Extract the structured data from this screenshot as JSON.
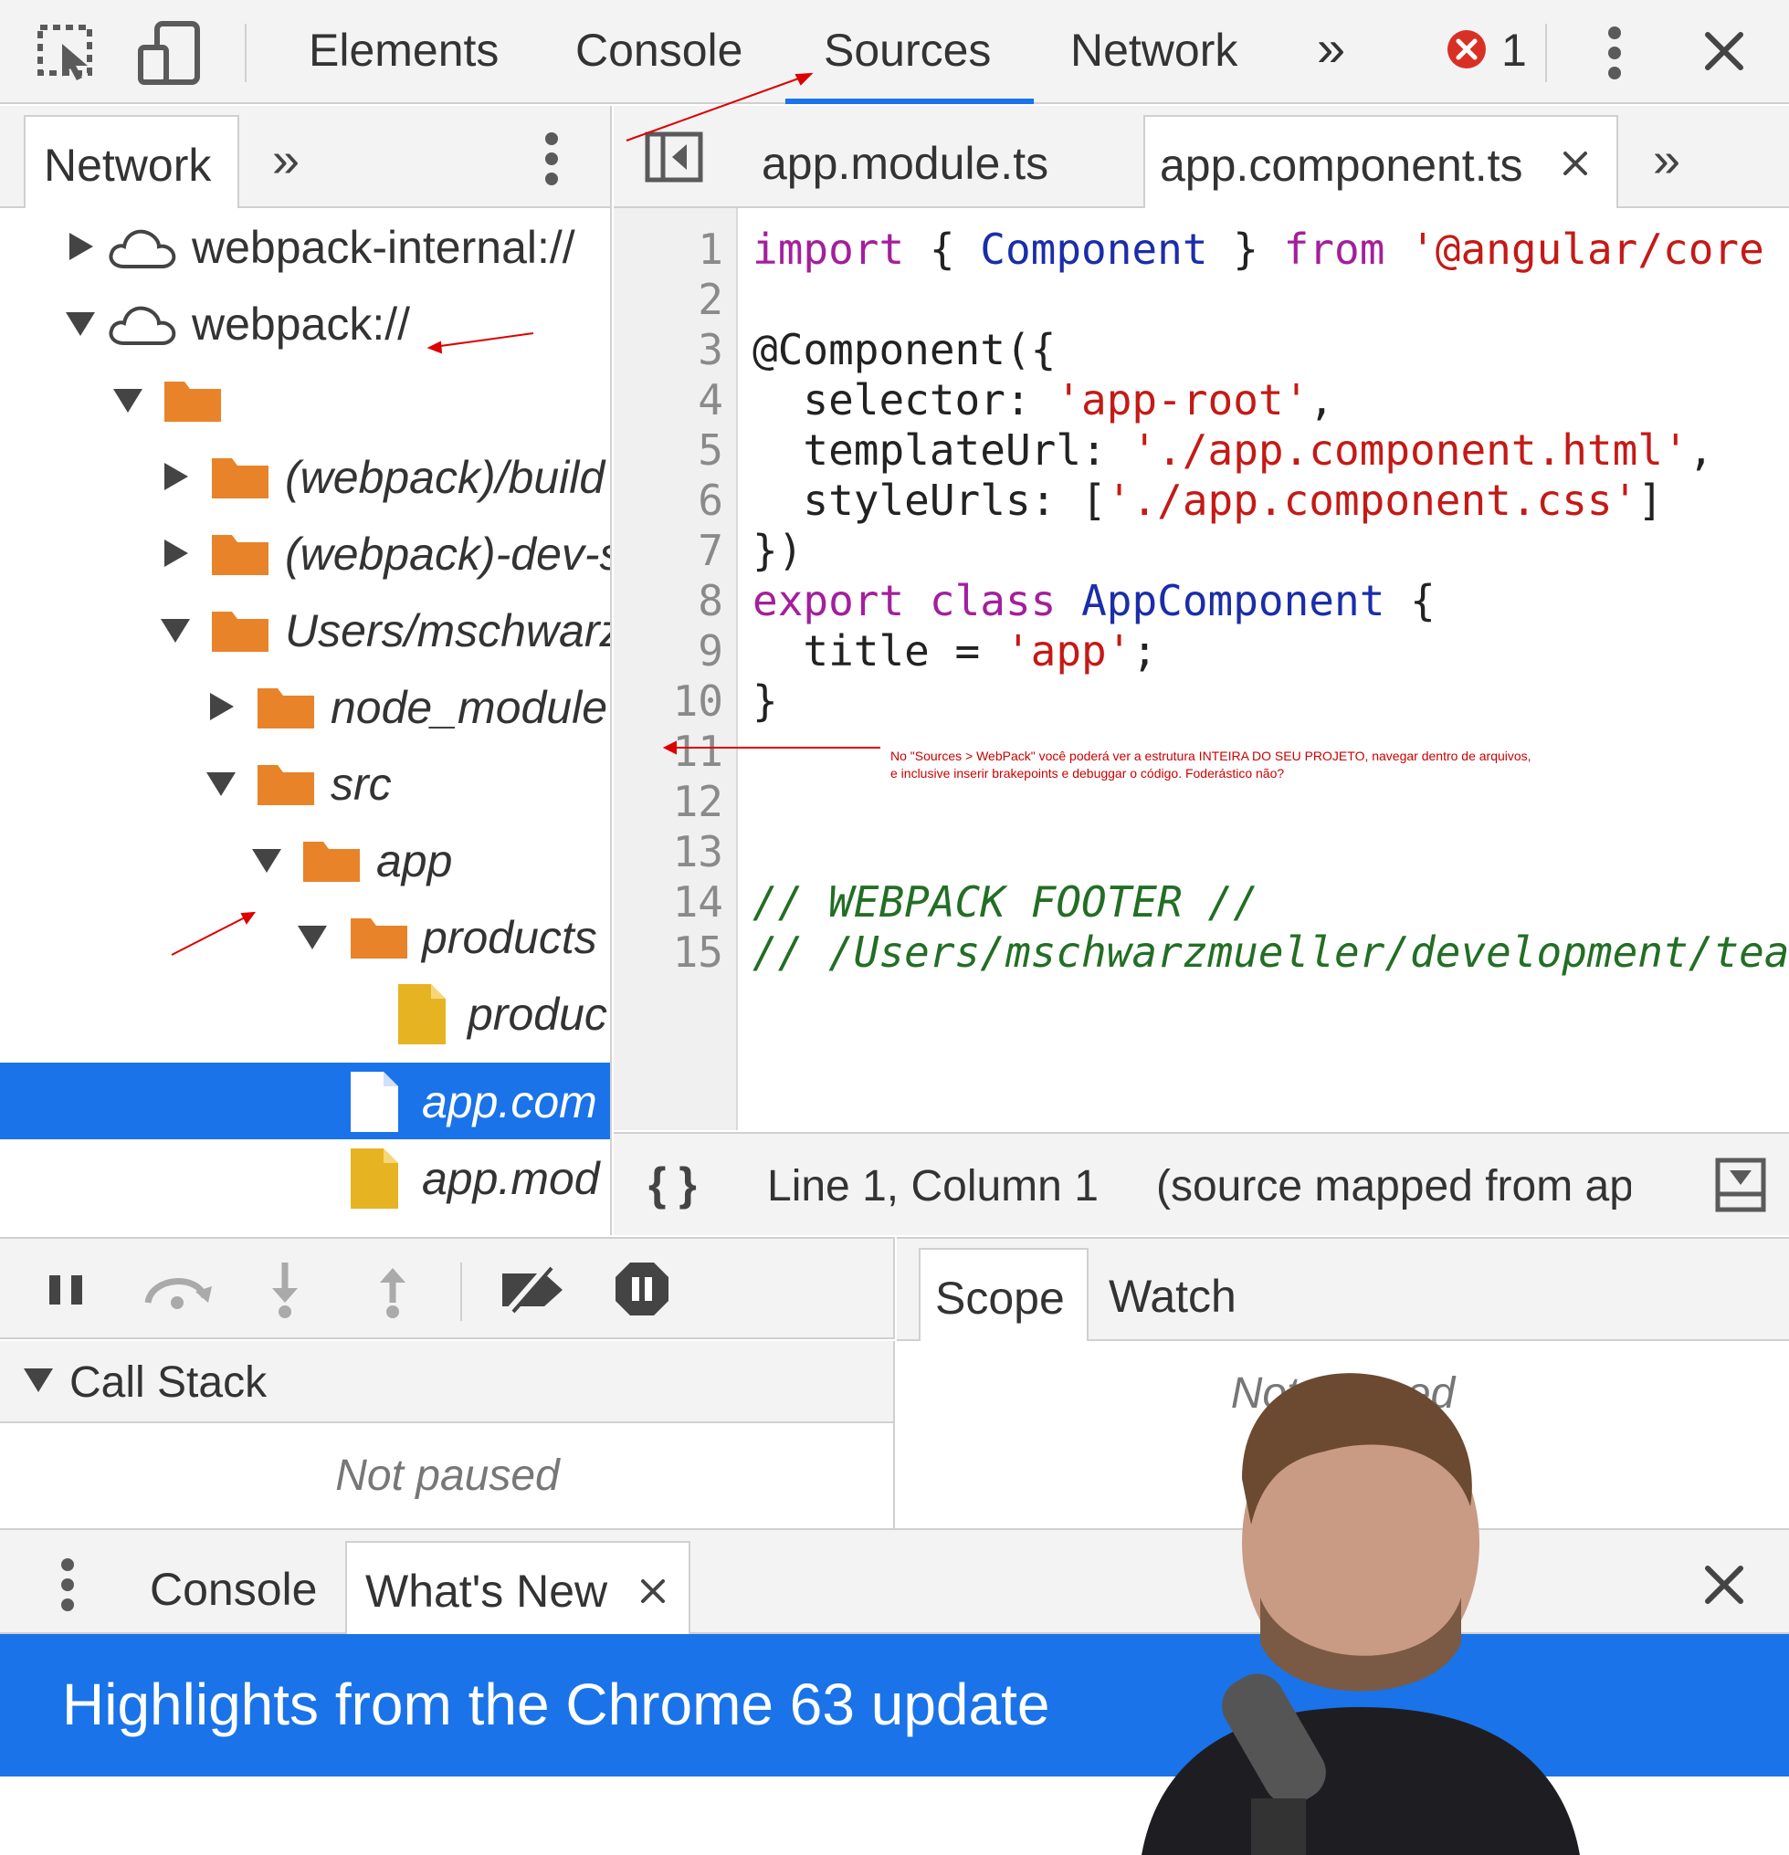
{
  "toolbar": {
    "tabs": [
      "Elements",
      "Console",
      "Sources",
      "Network"
    ],
    "active_tab": "Sources",
    "more": "»",
    "error_count": "1"
  },
  "navigator": {
    "tab": "Network",
    "more": "»",
    "tree": [
      {
        "label": "webpack-internal://",
        "kind": "cloud",
        "expanded": false,
        "depth": 0
      },
      {
        "label": "webpack://",
        "kind": "cloud",
        "expanded": true,
        "depth": 0
      },
      {
        "label": "",
        "kind": "folder",
        "expanded": true,
        "depth": 1
      },
      {
        "label": "(webpack)/build",
        "kind": "folder",
        "expanded": false,
        "depth": 2
      },
      {
        "label": "(webpack)-dev-s",
        "kind": "folder",
        "expanded": false,
        "depth": 2
      },
      {
        "label": "Users/mschwarz",
        "kind": "folder",
        "expanded": true,
        "depth": 2
      },
      {
        "label": "node_module",
        "kind": "folder",
        "expanded": false,
        "depth": 3
      },
      {
        "label": "src",
        "kind": "folder",
        "expanded": true,
        "depth": 3
      },
      {
        "label": "app",
        "kind": "folder",
        "expanded": true,
        "depth": 4
      },
      {
        "label": "products",
        "kind": "folder",
        "expanded": true,
        "depth": 5
      },
      {
        "label": "produc",
        "kind": "file",
        "depth": 6
      },
      {
        "label": "app.com",
        "kind": "file-selected",
        "depth": 5
      },
      {
        "label": "app.mod",
        "kind": "file",
        "depth": 5
      }
    ]
  },
  "editor": {
    "tabs": [
      "app.module.ts",
      "app.component.ts"
    ],
    "active_tab": "app.component.ts",
    "more": "»",
    "line_numbers": [
      "1",
      "2",
      "3",
      "4",
      "5",
      "6",
      "7",
      "8",
      "9",
      "10",
      "11",
      "12",
      "13",
      "14",
      "15"
    ],
    "code": {
      "l1a": "import",
      "l1b": " { ",
      "l1c": "Component",
      "l1d": " } ",
      "l1e": "from",
      "l1f": " ",
      "l1g": "'@angular/core",
      "l3": "@Component({",
      "l4a": "  selector: ",
      "l4b": "'app-root'",
      "l4c": ",",
      "l5a": "  templateUrl: ",
      "l5b": "'./app.component.html'",
      "l5c": ",",
      "l6a": "  styleUrls: [",
      "l6b": "'./app.component.css'",
      "l6c": "]",
      "l7": "})",
      "l8a": "export",
      "l8b": " ",
      "l8c": "class",
      "l8d": " ",
      "l8e": "AppComponent",
      "l8f": " {",
      "l9a": "  title = ",
      "l9b": "'app'",
      "l9c": ";",
      "l10": "}",
      "l14": "// WEBPACK FOOTER //",
      "l15": "// /Users/mschwarzmueller/development/tea"
    },
    "status": {
      "format_icon": "{ }",
      "position": "Line 1, Column 1",
      "source_map": "(source mapped from ap"
    }
  },
  "debugger": {
    "call_stack_label": "Call Stack",
    "call_stack_state": "Not paused",
    "scope_tabs": [
      "Scope",
      "Watch"
    ],
    "scope_state": "Not paused"
  },
  "drawer": {
    "tabs": [
      "Console",
      "What's New"
    ],
    "active_tab": "What's New",
    "banner": "Highlights from the Chrome 63 update"
  },
  "annotation": {
    "line1": "No \"Sources > WebPack\" você poderá ver a estrutura INTEIRA DO SEU PROJETO, navegar dentro de arquivos,",
    "line2": "e inclusive inserir brakepoints e debuggar o código. Foderástico não?"
  },
  "colors": {
    "accent": "#1a73e8",
    "folder": "#e8832a",
    "file": "#e6b422",
    "annotation": "#cc0000",
    "error": "#d93025"
  }
}
